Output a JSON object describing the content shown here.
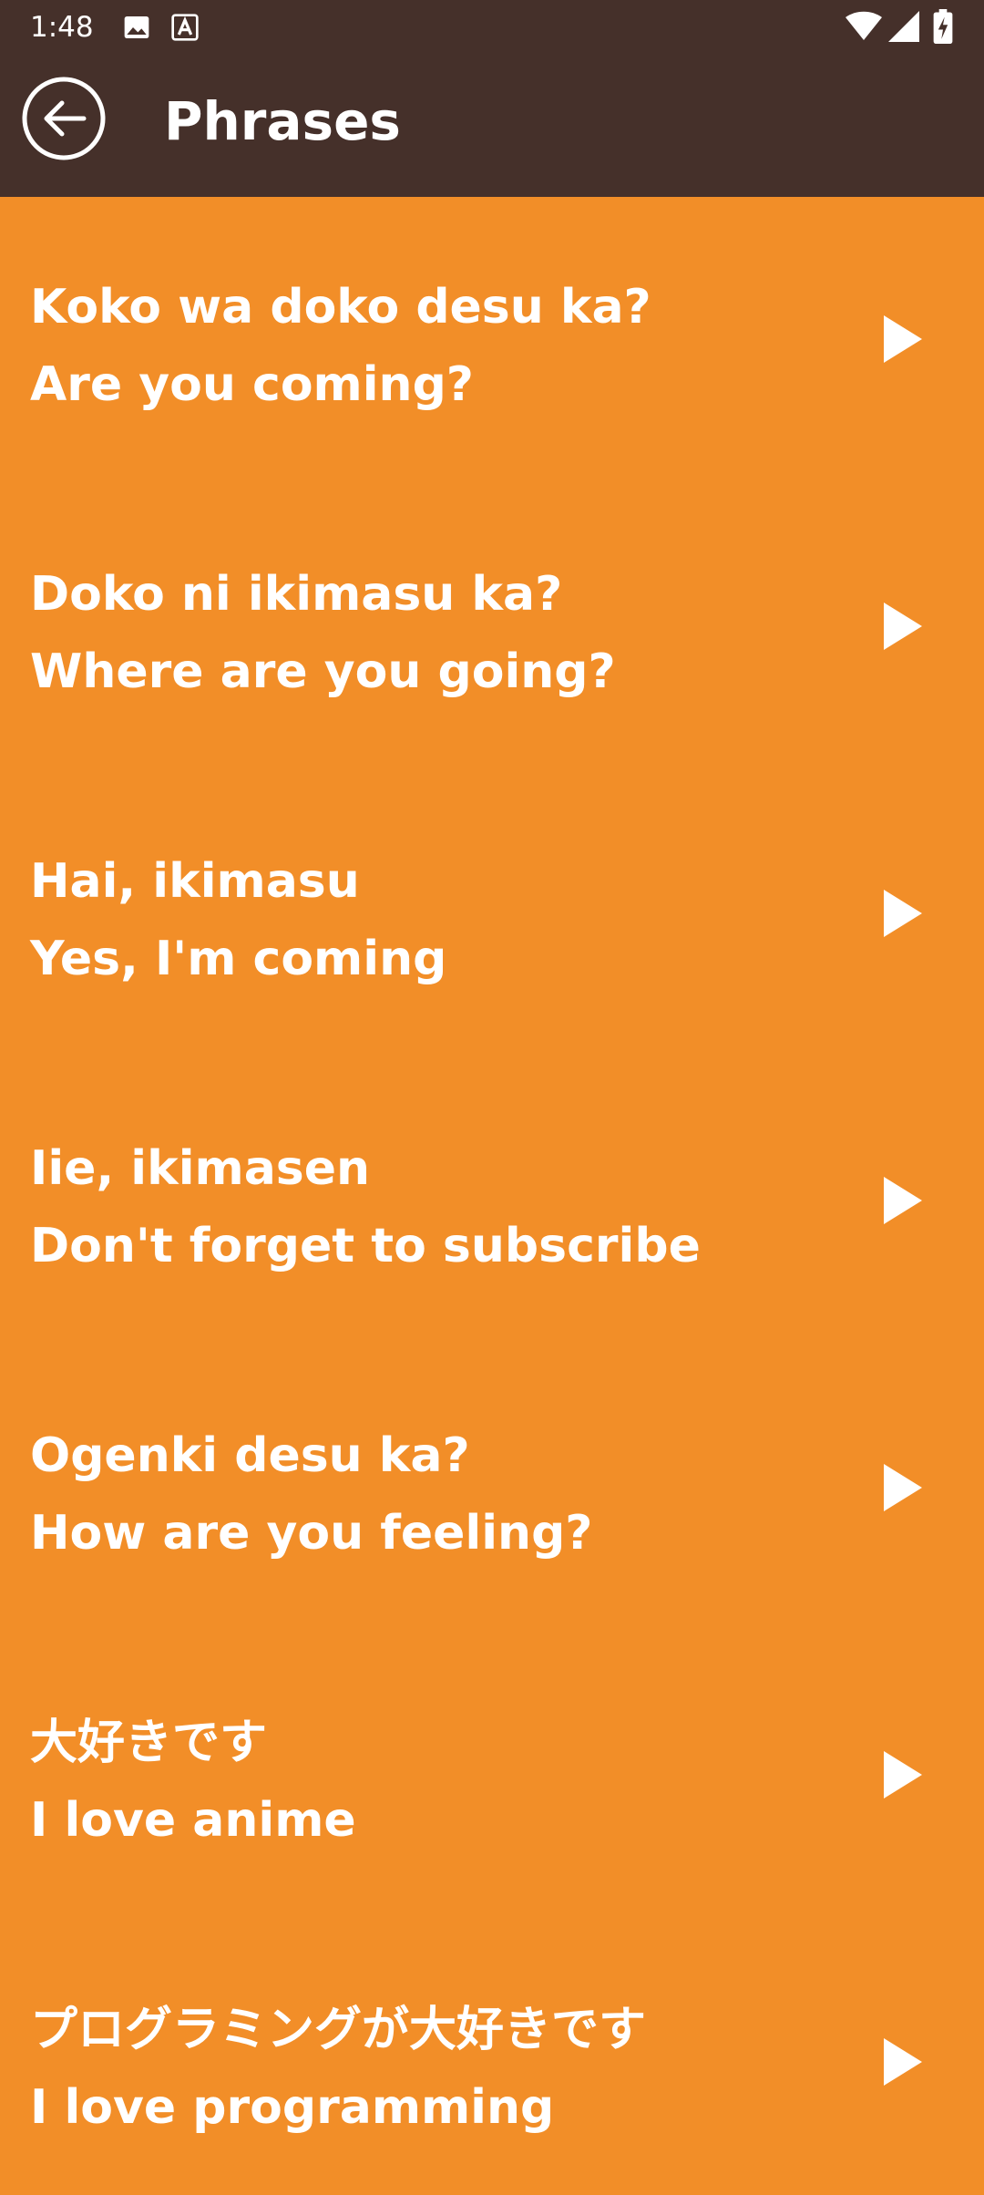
{
  "status_bar": {
    "time": "1:48",
    "icons": [
      "image-icon",
      "text-a-icon",
      "wifi-icon",
      "signal-icon",
      "battery-charging-icon"
    ]
  },
  "app_bar": {
    "title": "Phrases",
    "back_icon": "arrow-back-circle-icon"
  },
  "colors": {
    "app_bar": "#45302A",
    "background": "#F28E28",
    "text": "#FFFFFF"
  },
  "phrases": [
    {
      "line1": "Koko wa doko desu ka?",
      "line2": "Are you coming?",
      "icon": "play-icon"
    },
    {
      "line1": "Doko ni ikimasu ka?",
      "line2": "Where are you going?",
      "icon": "play-icon"
    },
    {
      "line1": "Hai, ikimasu",
      "line2": "Yes, I'm coming",
      "icon": "play-icon"
    },
    {
      "line1": "Iie, ikimasen",
      "line2": "Don't forget to subscribe",
      "icon": "play-icon"
    },
    {
      "line1": "Ogenki desu ka?",
      "line2": "How are you feeling?",
      "icon": "play-icon"
    },
    {
      "line1": "大好きです",
      "line2": "I love anime",
      "icon": "play-icon"
    },
    {
      "line1": "プログラミングが大好きです",
      "line2": "I love programming",
      "icon": "play-icon"
    }
  ]
}
